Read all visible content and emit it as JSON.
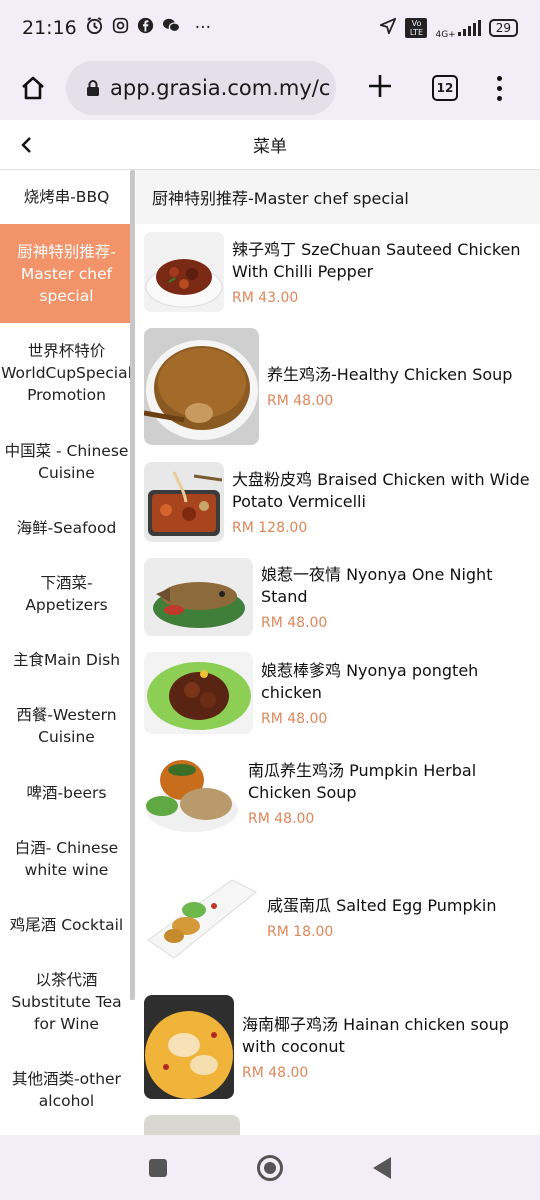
{
  "status": {
    "time": "21:16",
    "icons": [
      "alarm-icon",
      "instagram-icon",
      "facebook-icon",
      "wechat-icon",
      "more-icon"
    ],
    "more": "···",
    "network": "4G+",
    "volte": "Vo LTE",
    "battery": "29"
  },
  "browser": {
    "url": "app.grasia.com.my/c",
    "tab_count": "12"
  },
  "header": {
    "back": "‹",
    "title": "菜单"
  },
  "sidebar": {
    "items": [
      {
        "label": "烧烤串-BBQ"
      },
      {
        "label": "厨神特别推荐-Master chef special"
      },
      {
        "label": "世界杯特价 WorldCupSpecial Promotion"
      },
      {
        "label": "中国菜 - Chinese Cuisine"
      },
      {
        "label": "海鲜-Seafood"
      },
      {
        "label": "下酒菜-Appetizers"
      },
      {
        "label": "主食Main Dish"
      },
      {
        "label": "西餐-Western Cuisine"
      },
      {
        "label": "啤酒-beers"
      },
      {
        "label": "白酒- Chinese white wine"
      },
      {
        "label": "鸡尾酒 Cocktail"
      },
      {
        "label": "以茶代酒 Substitute Tea for Wine"
      },
      {
        "label": "其他酒类-other alcohol"
      }
    ],
    "active_index": 1
  },
  "main": {
    "section_title": "厨神特别推荐-Master chef special",
    "items": [
      {
        "name": "辣子鸡丁 SzeChuan Sauteed Chicken With Chilli Pepper",
        "price": "RM 43.00"
      },
      {
        "name": "养生鸡汤-Healthy Chicken Soup",
        "price": "RM 48.00"
      },
      {
        "name": "大盘粉皮鸡 Braised Chicken with Wide Potato Vermicelli",
        "price": "RM 128.00"
      },
      {
        "name": "娘惹一夜情 Nyonya One Night Stand",
        "price": "RM 48.00"
      },
      {
        "name": "娘惹棒爹鸡 Nyonya pongteh chicken",
        "price": "RM 48.00"
      },
      {
        "name": "南瓜养生鸡汤 Pumpkin Herbal Chicken Soup",
        "price": "RM 48.00"
      },
      {
        "name": "咸蛋南瓜 Salted Egg Pumpkin",
        "price": "RM 18.00"
      },
      {
        "name": "海南椰子鸡汤 Hainan chicken soup with coconut",
        "price": "RM 48.00"
      }
    ]
  },
  "colors": {
    "accent": "#f3936a",
    "price": "#e0875a",
    "chrome": "#f3edf7"
  },
  "nav": {
    "icons": [
      "recents-icon",
      "home-icon",
      "back-icon"
    ]
  }
}
